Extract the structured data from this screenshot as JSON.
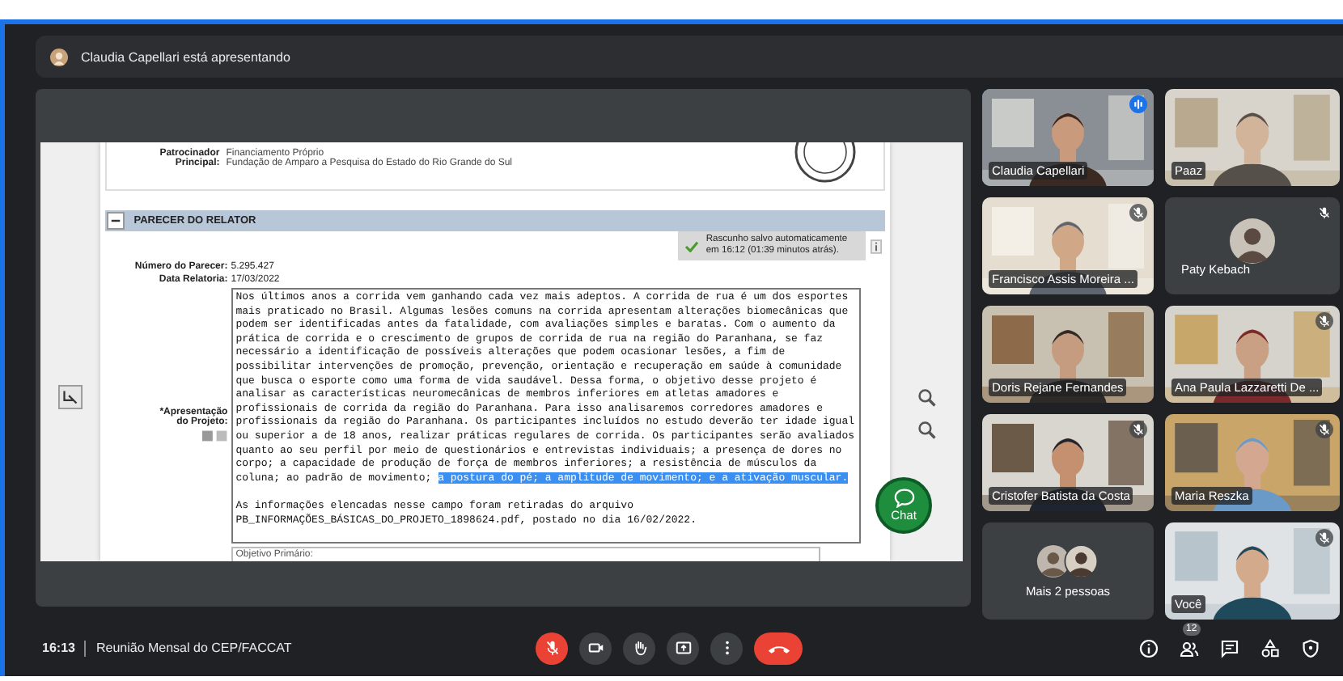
{
  "presenter_banner": {
    "text": "Claudia Capellari está apresentando"
  },
  "document": {
    "sponsor_label": "Patrocinador Principal:",
    "sponsor_values": [
      "Financiamento Próprio",
      "Fundação de Amparo a Pesquisa do Estado do Rio Grande do Sul"
    ],
    "section": {
      "title": "PARECER DO RELATOR",
      "expanded": true
    },
    "autosave_notice": "Rascunho salvo automaticamente em 16:12 (01:39 minutos atrás).",
    "fields": [
      {
        "label": "Número do Parecer:",
        "value": "5.295.427"
      },
      {
        "label": "Data Relatoria:",
        "value": "17/03/2022"
      }
    ],
    "presentation": {
      "label": "*Apresentação do Projeto:",
      "paragraphs": [
        {
          "segments": [
            {
              "text": "Nos últimos anos a corrida vem ganhando cada vez mais adeptos. A corrida de rua é um dos esportes mais praticado no Brasil. Algumas lesões comuns na corrida apresentam alterações biomecânicas que podem ser identificadas antes da fatalidade, com avaliações simples e baratas. Com o aumento da prática de corrida e o crescimento de grupos de corrida de rua na região do Paranhana, se faz necessário a identificação de possíveis alterações que podem ocasionar lesões, a fim de possibilitar intervenções de promoção, prevenção, orientação e recuperação em saúde à comunidade que busca o esporte como uma forma de vida saudável. Dessa forma, o objetivo desse projeto é analisar as características neuromecânicas de membros inferiores em atletas amadores e profissionais de corrida da região do Paranhana. Para isso analisaremos corredores amadores e profissionais da região do Paranhana. Os participantes incluídos no estudo deverão ter idade igual ou superior a de 18 anos, realizar práticas regulares de corrida. Os participantes serão avaliados quanto ao seu perfil por meio de questionários e entrevistas individuais; a presença de dores no corpo; a capacidade de produção de força de membros inferiores; a resistência de músculos da coluna; ao padrão de movimento; ",
              "highlighted": false
            },
            {
              "text": "a postura do pé; a amplitude de movimento; e a ativação muscular.",
              "highlighted": true
            }
          ]
        },
        {
          "segments": [
            {
              "text": "As informações elencadas nesse campo foram retiradas do arquivo PB_INFORMAÇÕES_BÁSICAS_DO_PROJETO_1898624.pdf, postado no dia 16/02/2022.",
              "highlighted": false
            }
          ]
        }
      ]
    },
    "next_field": "Objetivo Primário:"
  },
  "chat_button": {
    "label": "Chat"
  },
  "tiles": [
    {
      "kind": "video",
      "name": "Claudia Capellari",
      "speaking": true,
      "muted": false
    },
    {
      "kind": "video",
      "name": "Paaz",
      "speaking": false,
      "muted": false
    },
    {
      "kind": "video",
      "name": "Francisco Assis Moreira ...",
      "speaking": false,
      "muted": true
    },
    {
      "kind": "avatar",
      "name": "Paty Kebach",
      "speaking": false,
      "muted": true
    },
    {
      "kind": "video",
      "name": "Doris Rejane Fernandes",
      "speaking": false,
      "muted": false
    },
    {
      "kind": "video",
      "name": "Ana Paula Lazzaretti De ...",
      "speaking": false,
      "muted": true
    },
    {
      "kind": "video",
      "name": "Cristofer Batista da Costa",
      "speaking": false,
      "muted": true
    },
    {
      "kind": "video",
      "name": "Maria Reszka",
      "speaking": false,
      "muted": true
    },
    {
      "kind": "overflow",
      "name": "Mais 2 pessoas",
      "speaking": false,
      "muted": false
    },
    {
      "kind": "video",
      "name": "Você",
      "speaking": false,
      "muted": true
    }
  ],
  "bottom_bar": {
    "time": "16:13",
    "meeting_title": "Reunião Mensal do CEP/FACCAT",
    "mic_on": false,
    "participants_badge": "12"
  }
}
